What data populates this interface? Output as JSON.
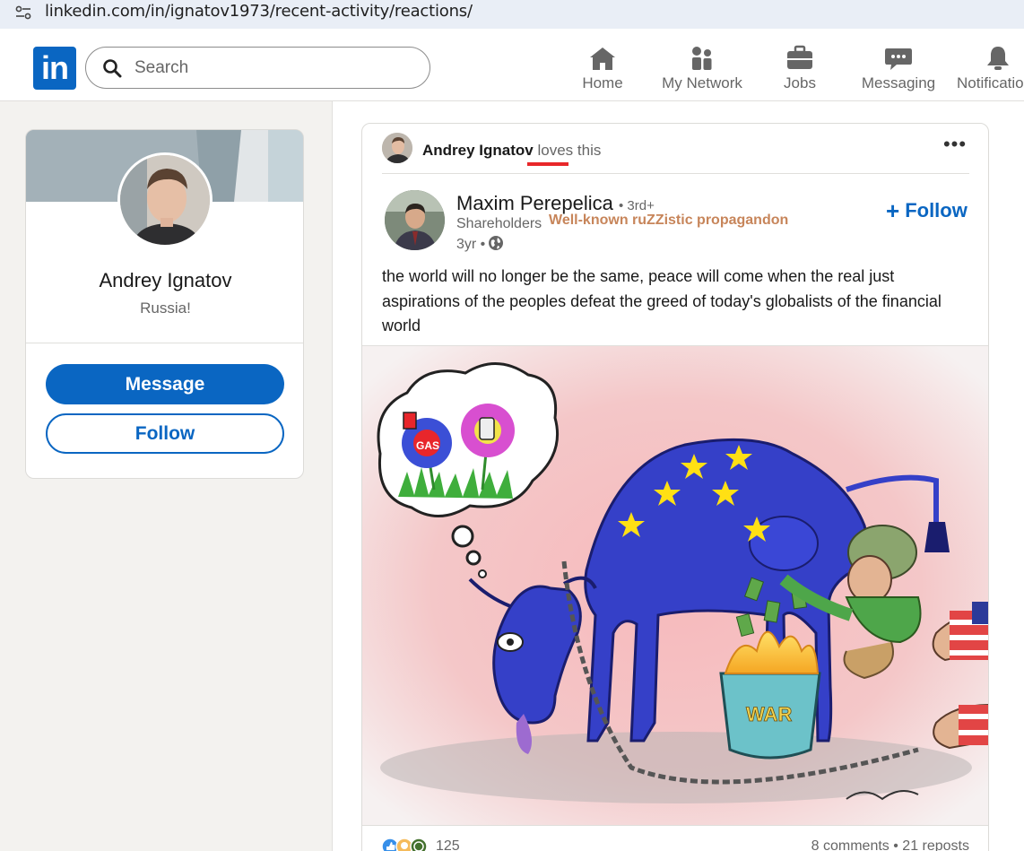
{
  "browser": {
    "url": "linkedin.com/in/ignatov1973/recent-activity/reactions/"
  },
  "header": {
    "logo_text": "in",
    "search_placeholder": "Search",
    "nav": [
      {
        "label": "Home",
        "icon": "home-icon"
      },
      {
        "label": "My Network",
        "icon": "network-icon"
      },
      {
        "label": "Jobs",
        "icon": "briefcase-icon"
      },
      {
        "label": "Messaging",
        "icon": "messaging-icon"
      },
      {
        "label": "Notifications",
        "icon": "bell-icon"
      }
    ]
  },
  "profile_card": {
    "name": "Andrey Ignatov",
    "headline": "Russia!",
    "message_label": "Message",
    "follow_label": "Follow"
  },
  "post": {
    "activity": {
      "actor": "Andrey Ignatov",
      "verb": "loves",
      "suffix": "this"
    },
    "author": {
      "name": "Maxim Perepelica",
      "degree": "• 3rd+",
      "headline": "Shareholders",
      "annotation": "Well-known ruZZistic propagandon",
      "time": "3yr •"
    },
    "follow_label": "Follow",
    "text": "the world will no longer be the same, peace will come when the real just aspirations of the peoples defeat the greed of today's globalists of the financial world",
    "image_text": {
      "gas": "GAS",
      "war": "WAR"
    },
    "reaction_count": "125",
    "comments_reposts": "8 comments • 21 reposts"
  },
  "colors": {
    "brand": "#0a66c2",
    "annotation": "#c7855a",
    "underline": "#e8272a"
  }
}
